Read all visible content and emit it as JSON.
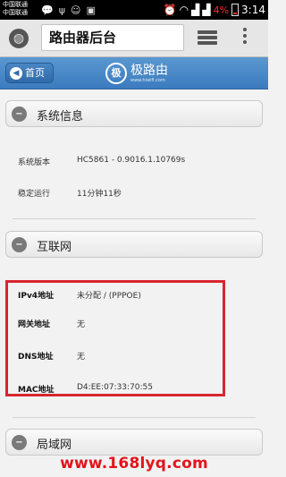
{
  "status_bar": {
    "carrier_1": "中国联通",
    "carrier_2": "中国联通",
    "battery": "4%",
    "time": "3:14"
  },
  "browser": {
    "url_title": "路由器后台"
  },
  "header": {
    "home_label": "首页",
    "logo_text": "极路由",
    "logo_url": "www.hiwifi.com"
  },
  "system_info": {
    "title": "系统信息",
    "rows": [
      {
        "label": "系统版本",
        "value": "HC5861 - 0.9016.1.10769s"
      },
      {
        "label": "稳定运行",
        "value": "11分钟11秒"
      }
    ]
  },
  "internet": {
    "title": "互联网",
    "rows": [
      {
        "label": "IPv4地址",
        "value": "未分配 / (PPPOE)"
      },
      {
        "label": "网关地址",
        "value": "无"
      },
      {
        "label": "DNS地址",
        "value": "无"
      },
      {
        "label": "MAC地址",
        "value": "D4:EE:07:33:70:55"
      }
    ]
  },
  "lan": {
    "title": "局域网"
  },
  "watermark": "www.168lyq.com"
}
